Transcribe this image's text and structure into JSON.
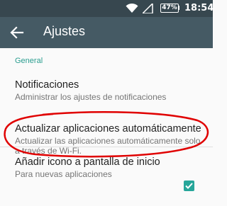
{
  "status_bar": {
    "battery": "47%",
    "time": "18:54",
    "icons": [
      "wifi-icon",
      "signal-icon",
      "battery-icon"
    ]
  },
  "app_bar": {
    "title": "Ajustes",
    "back_icon": "arrow-back-icon"
  },
  "section": {
    "header": "General"
  },
  "preferences": [
    {
      "title": "Notificaciones",
      "summary": "Administrar los ajustes de notificaciones"
    },
    {
      "title": "Actualizar aplicaciones automáticamente",
      "summary": "Actualizar las aplicaciones automáticamente solo a través de Wi-Fi.",
      "annotated": true
    },
    {
      "title": "Añadir icono a pantalla de inicio",
      "summary": "Para nuevas aplicaciones",
      "checked": true
    }
  ],
  "colors": {
    "status_bar": "#37474f",
    "app_bar": "#455a64",
    "accent": "#26a69a",
    "annotation": "#e00000"
  }
}
